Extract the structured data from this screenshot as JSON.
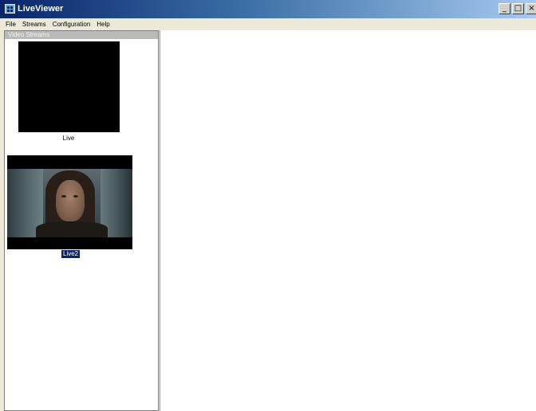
{
  "window": {
    "title": "LiveViewer",
    "controls": {
      "minimize": "_",
      "maximize": "□",
      "close": "×"
    }
  },
  "menu": {
    "items": [
      {
        "label": "File"
      },
      {
        "label": "Streams"
      },
      {
        "label": "Configuration"
      },
      {
        "label": "Help"
      }
    ]
  },
  "streams_panel": {
    "header": "Video Streams",
    "streams": [
      {
        "label": "Live",
        "selected": false
      },
      {
        "label": "Live2",
        "selected": true
      }
    ]
  },
  "colors": {
    "title_bar_start": "#0a246a",
    "title_bar_end": "#a6caf0",
    "selection": "#0a246a"
  },
  "icons": [
    "app-icon",
    "minimize-icon",
    "maximize-icon",
    "close-icon"
  ]
}
